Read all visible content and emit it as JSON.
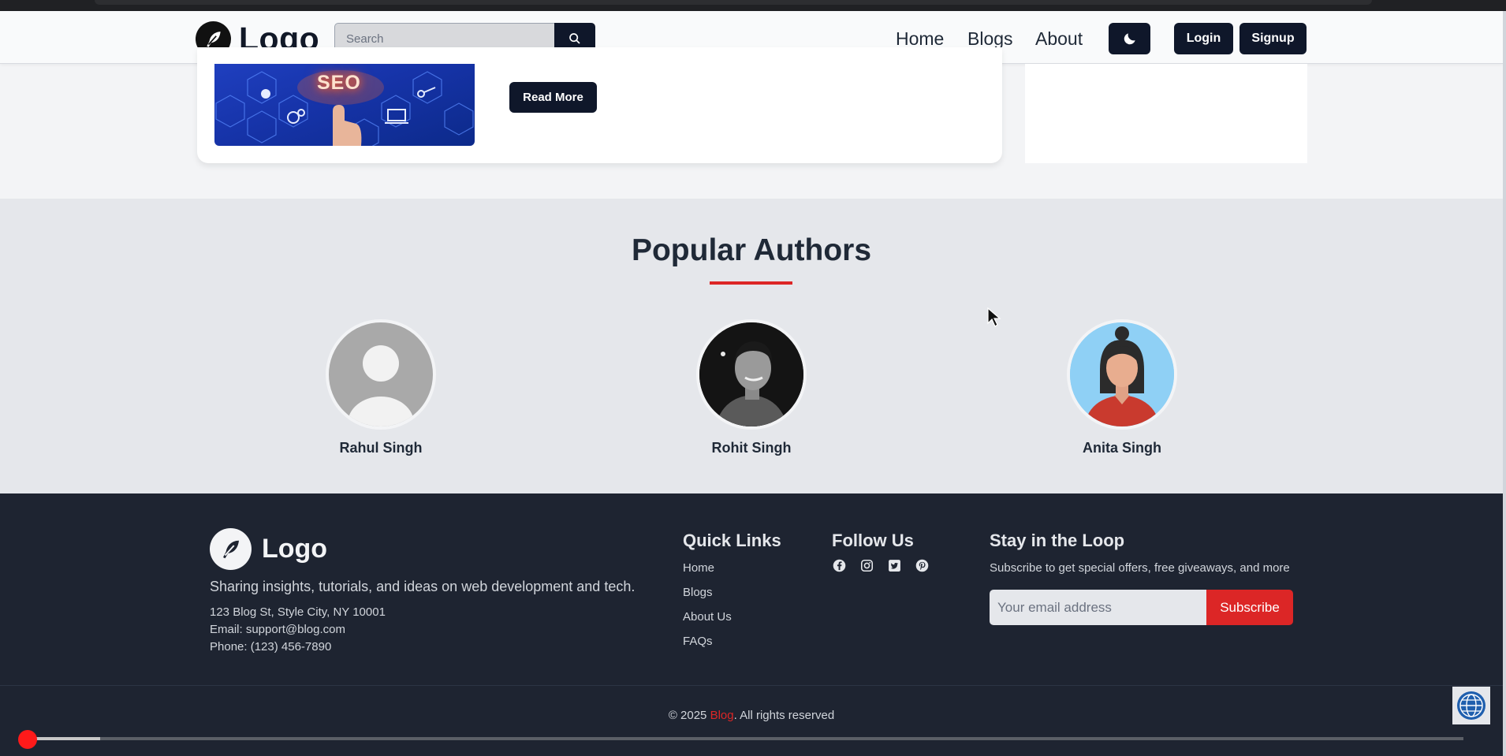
{
  "navbar": {
    "logo_text": "Logo",
    "search_placeholder": "Search",
    "links": [
      "Home",
      "Blogs",
      "About"
    ],
    "login_label": "Login",
    "signup_label": "Signup"
  },
  "post": {
    "image_text": "SEO",
    "read_more_label": "Read More"
  },
  "authors": {
    "title": "Popular Authors",
    "list": [
      {
        "name": "Rahul Singh"
      },
      {
        "name": "Rohit Singh"
      },
      {
        "name": "Anita Singh"
      }
    ]
  },
  "footer": {
    "logo_text": "Logo",
    "tagline": "Sharing insights, tutorials, and ideas on web development and tech.",
    "address": "123 Blog St, Style City, NY 10001",
    "email": "Email: support@blog.com",
    "phone": "Phone: (123) 456-7890",
    "quick_links_title": "Quick Links",
    "quick_links": [
      "Home",
      "Blogs",
      "About Us",
      "FAQs"
    ],
    "follow_title": "Follow Us",
    "social_icons": [
      "facebook-icon",
      "instagram-icon",
      "twitter-icon",
      "pinterest-icon"
    ],
    "newsletter_title": "Stay in the Loop",
    "newsletter_text": "Subscribe to get special offers, free giveaways, and more",
    "email_placeholder": "Your email address",
    "subscribe_label": "Subscribe",
    "copyright_prefix": "© 2025 ",
    "copyright_brand": "Blog",
    "copyright_suffix": ". All rights reserved"
  },
  "video": {
    "progress": 0.05
  },
  "colors": {
    "accent": "#dc2626",
    "dark": "#0f172a",
    "footer_bg": "#1e2431"
  }
}
